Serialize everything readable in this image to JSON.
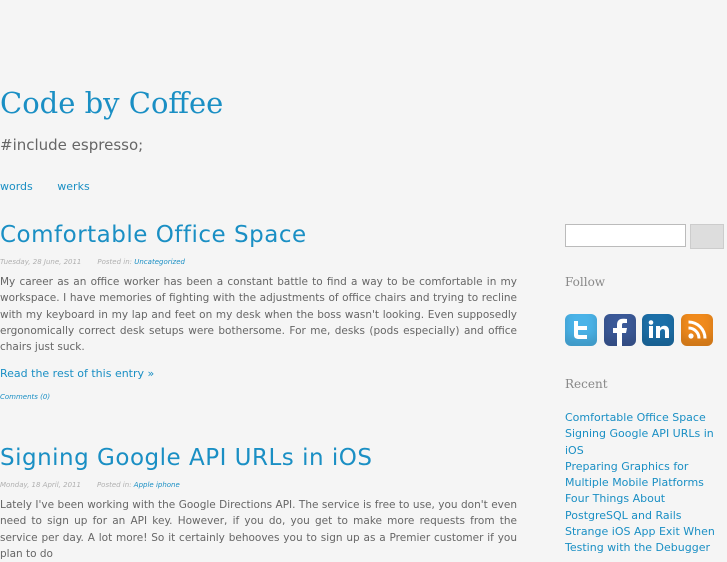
{
  "site": {
    "title": "Code by Coffee",
    "tagline": "#include espresso;"
  },
  "nav": [
    {
      "label": "words"
    },
    {
      "label": "werks"
    }
  ],
  "posts": [
    {
      "title": "Comfortable Office Space",
      "date": "Tuesday, 28 June, 2011",
      "posted_in_label": "Posted in:",
      "category": "Uncategorized",
      "body": "My career as an office worker has been a constant battle to find a way to be comfortable in my workspace. I have memories of fighting with the adjustments of office chairs and trying to recline with my keyboard in my lap and feet on my desk when the boss wasn't looking. Even supposedly ergonomically correct desk setups were bothersome. For me, desks (pods especially) and office chairs just suck.",
      "read_more": "Read the rest of this entry »",
      "comments": "Comments (0)"
    },
    {
      "title": "Signing Google API URLs in iOS",
      "date": "Monday, 18 April, 2011",
      "posted_in_label": "Posted in:",
      "category": "Apple iphone",
      "body": "Lately I've been working with the Google Directions API. The service is free to use, you don't even need to sign up for an API key. However, if you do, you get to make more requests from the service per day. A lot more! So it certainly behooves you to sign up as a Premier customer if you plan to do"
    }
  ],
  "sidebar": {
    "search": {
      "value": "",
      "button_label": ""
    },
    "follow_title": "Follow",
    "social": [
      {
        "name": "twitter",
        "color": "#4ab3e8"
      },
      {
        "name": "facebook",
        "color": "#3b5998"
      },
      {
        "name": "linkedin",
        "color": "#1c6fa8"
      },
      {
        "name": "rss",
        "color": "#f08a1c"
      }
    ],
    "recent_title": "Recent",
    "recent": [
      "Comfortable Office Space",
      "Signing Google API URLs in iOS",
      "Preparing Graphics for Multiple Mobile Platforms",
      "Four Things About PostgreSQL and Rails",
      "Strange iOS App Exit When Testing with the Debugger"
    ]
  }
}
